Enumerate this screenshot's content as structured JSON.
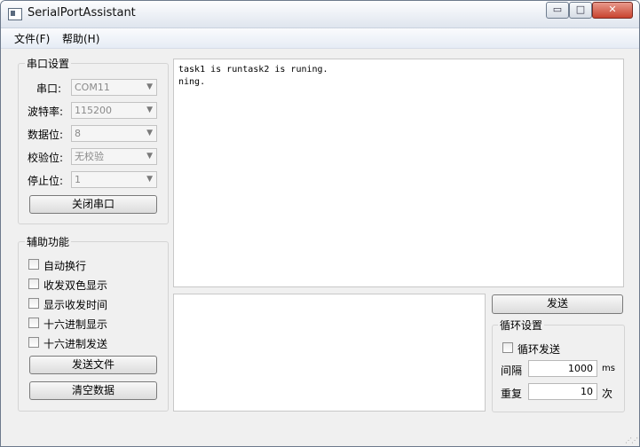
{
  "window": {
    "title": "SerialPortAssistant",
    "controls": {
      "minimize": "▭",
      "maximize": "□",
      "close": "✕"
    }
  },
  "menubar": {
    "items": [
      {
        "label": "文件(F)"
      },
      {
        "label": "帮助(H)"
      }
    ]
  },
  "serial_settings": {
    "title": "串口设置",
    "fields": [
      {
        "label": "串口:",
        "value": "COM11"
      },
      {
        "label": "波特率:",
        "value": "115200"
      },
      {
        "label": "数据位:",
        "value": "8"
      },
      {
        "label": "校验位:",
        "value": "无校验"
      },
      {
        "label": "停止位:",
        "value": "1"
      }
    ],
    "toggle_button": "关闭串口"
  },
  "aux_functions": {
    "title": "辅助功能",
    "options": [
      {
        "label": "自动换行",
        "checked": false
      },
      {
        "label": "收发双色显示",
        "checked": false
      },
      {
        "label": "显示收发时间",
        "checked": false
      },
      {
        "label": "十六进制显示",
        "checked": false
      },
      {
        "label": "十六进制发送",
        "checked": false
      }
    ],
    "send_file_button": "发送文件",
    "clear_data_button": "清空数据"
  },
  "receive_area": {
    "text": "task1 is runtask2 is runing.\nning."
  },
  "send_area": {
    "text": ""
  },
  "send_button": "发送",
  "loop_settings": {
    "title": "循环设置",
    "loop_send_label": "循环发送",
    "loop_send_checked": false,
    "interval_label": "间隔",
    "interval_value": "1000",
    "interval_unit": "ms",
    "repeat_label": "重复",
    "repeat_value": "10",
    "repeat_unit": "次"
  }
}
